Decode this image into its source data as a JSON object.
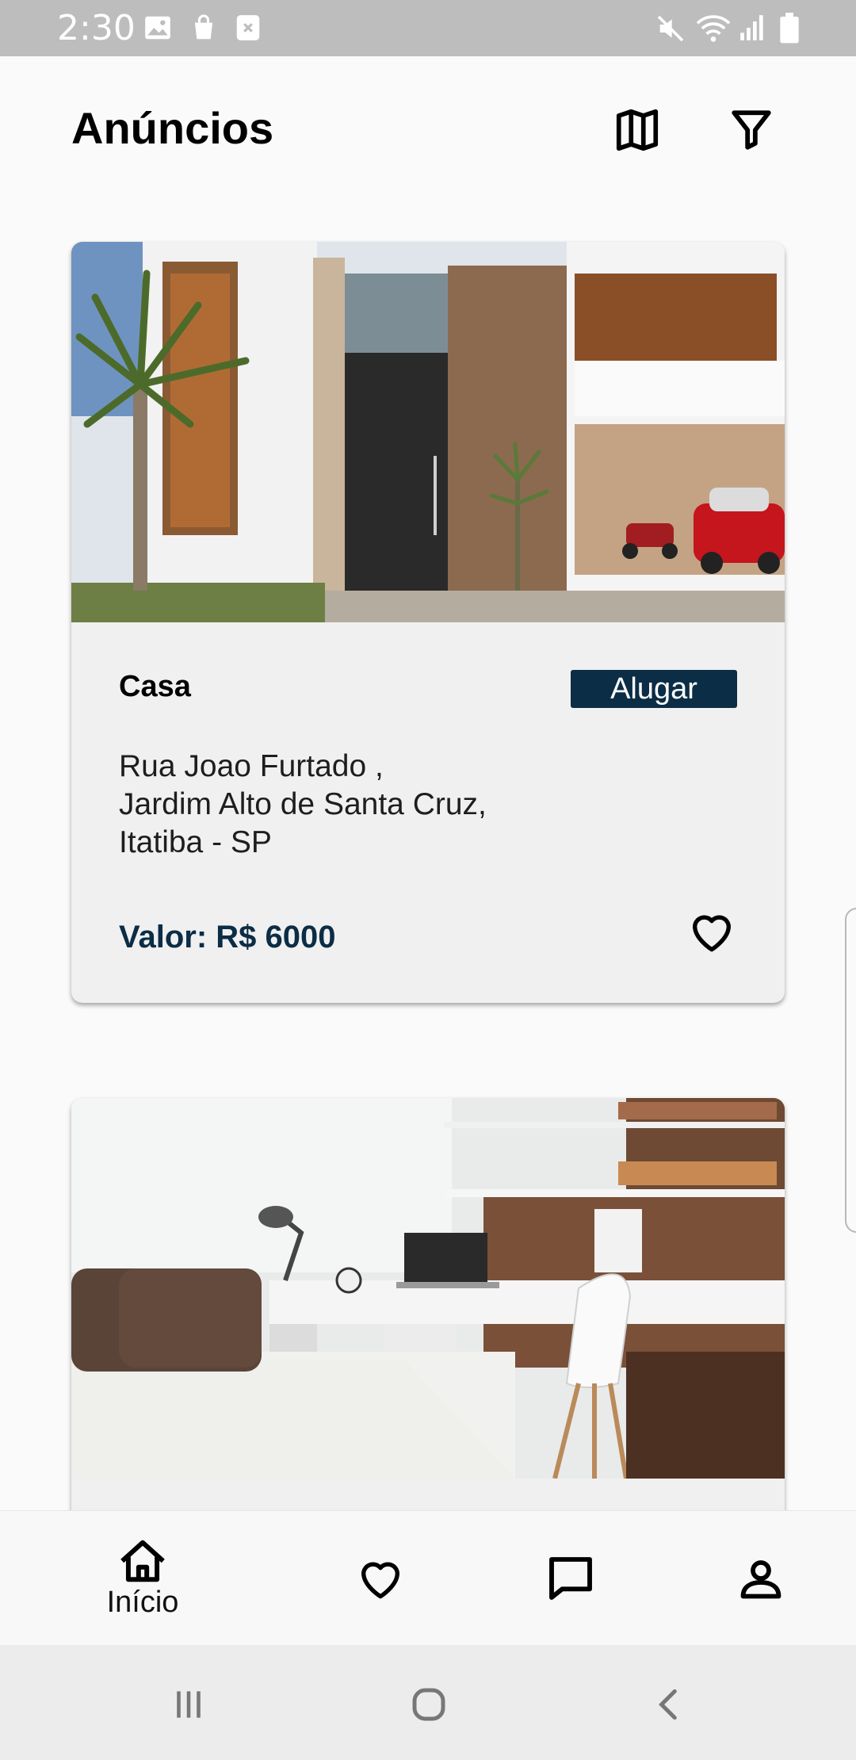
{
  "status_bar": {
    "time": "2:30",
    "left_icons": [
      "image-icon",
      "shopping-bag-icon",
      "close-box-icon"
    ],
    "right_icons": [
      "mute-icon",
      "wifi-icon",
      "signal-icon",
      "battery-icon"
    ]
  },
  "header": {
    "title": "Anúncios",
    "actions": [
      "map-icon",
      "filter-icon"
    ]
  },
  "listings": [
    {
      "photo": "modern-house-facade-photo",
      "type": "Casa",
      "badge": "Alugar",
      "address_line1": "Rua Joao Furtado ,",
      "address_line2": "Jardim Alto de Santa Cruz,",
      "address_line3": "Itatiba - SP",
      "price": "Valor: R$ 6000",
      "favorite_icon": "heart-outline-icon"
    },
    {
      "photo": "bedroom-with-desk-photo"
    }
  ],
  "bottom_nav": {
    "home_label": "Início",
    "items": [
      "home-icon",
      "heart-icon",
      "chat-icon",
      "profile-icon"
    ]
  },
  "system_nav": [
    "recents-icon",
    "home-circle-icon",
    "back-icon"
  ],
  "colors": {
    "primary": "#0b2d45",
    "status_bar": "#bdbdbd",
    "card_bg": "#f0f0f0",
    "background": "#fafafa"
  }
}
